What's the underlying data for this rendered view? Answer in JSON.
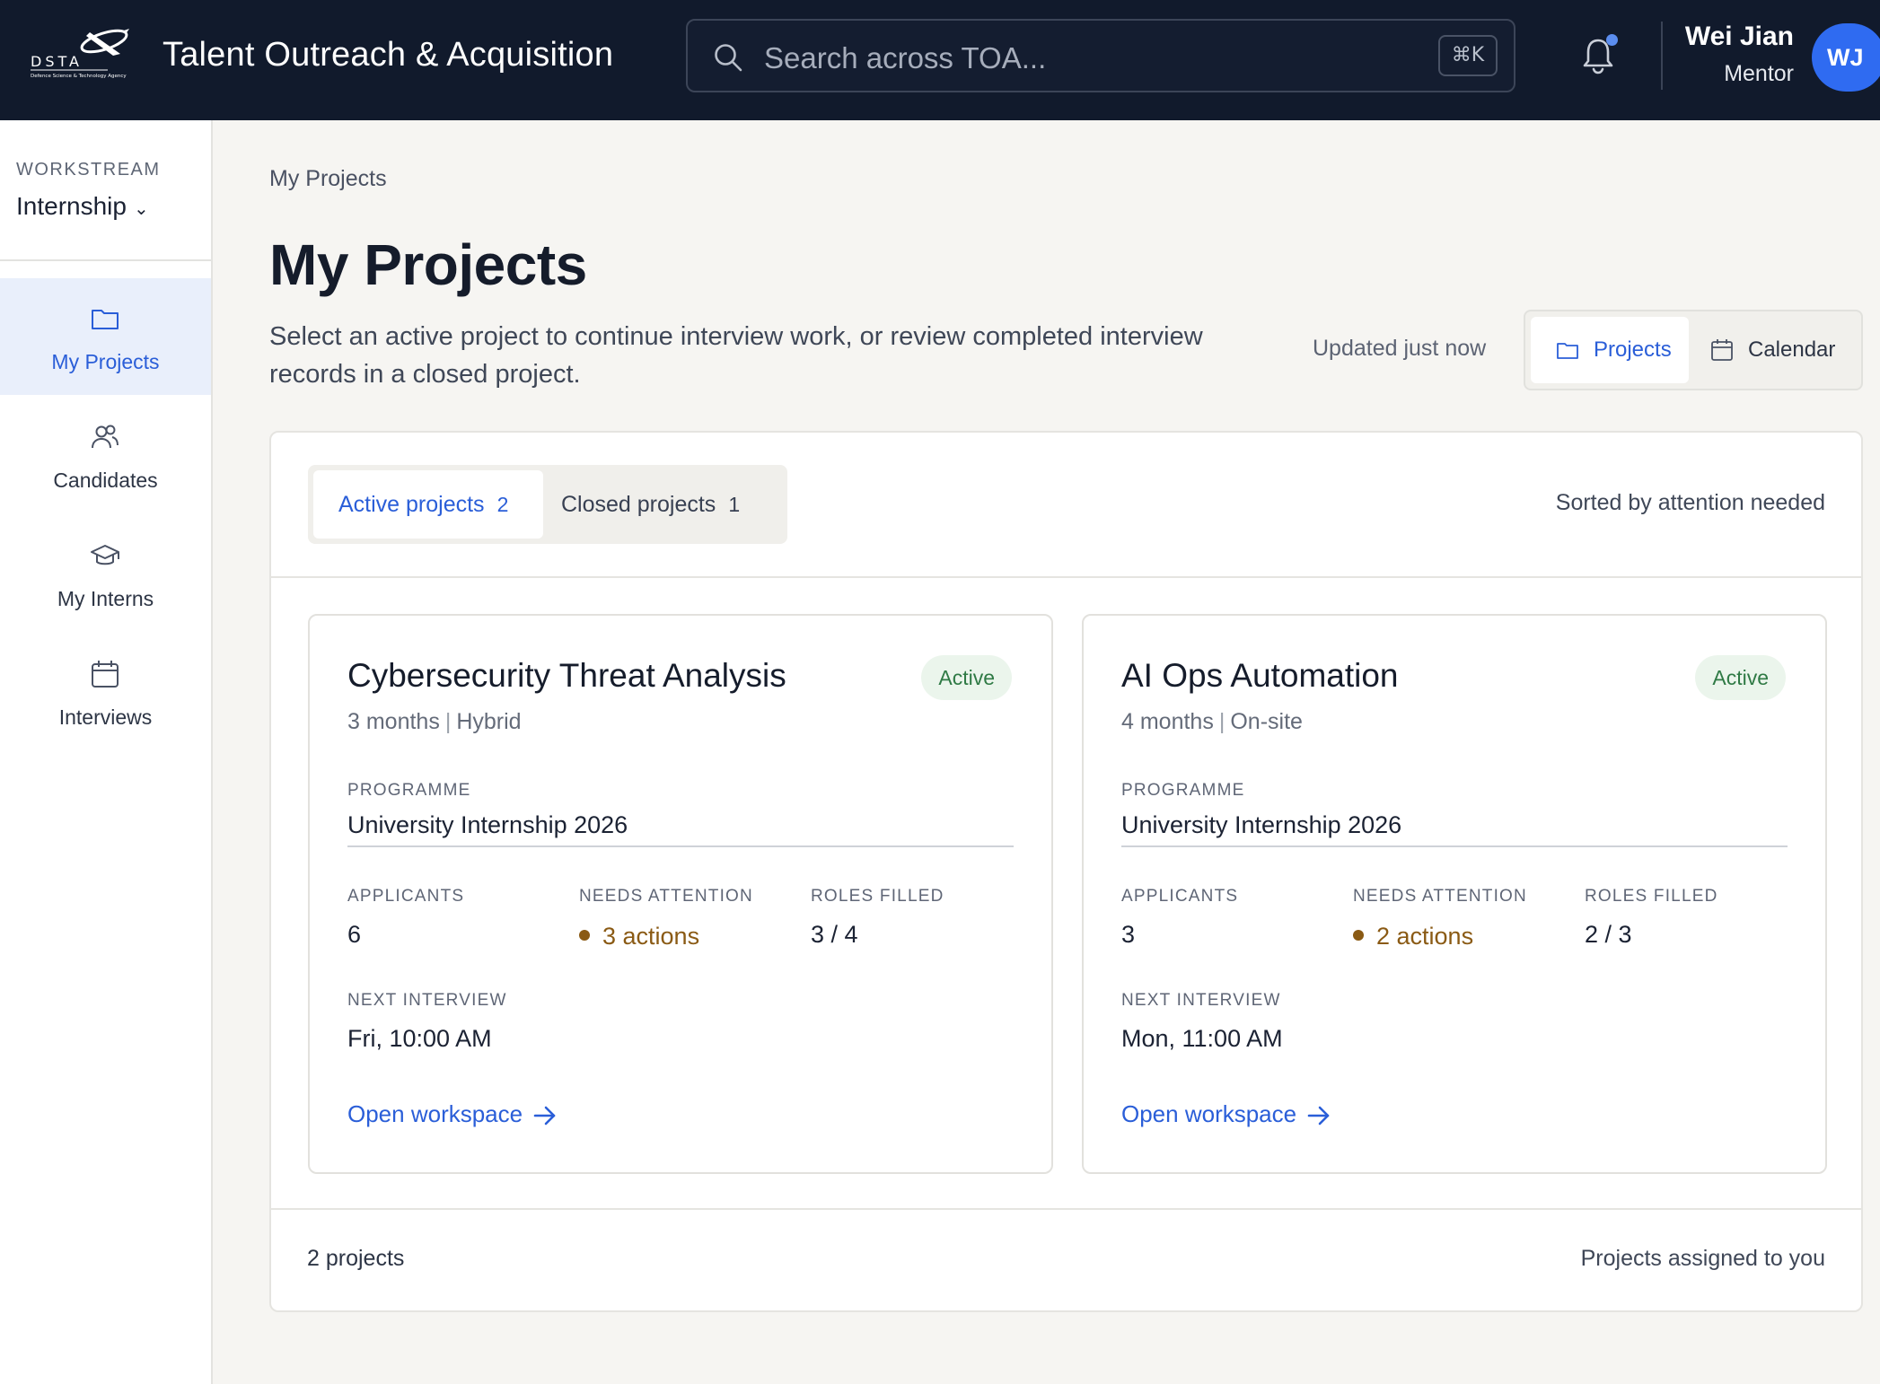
{
  "header": {
    "logo_text": "DSTA",
    "logo_subtext": "Defence Science & Technology Agency",
    "app_title": "Talent Outreach & Acquisition",
    "search_placeholder": "Search across TOA...",
    "search_shortcut": "⌘K",
    "notification_unread": true,
    "user_name": "Wei Jian",
    "user_role": "Mentor",
    "user_initials": "WJ"
  },
  "sidebar": {
    "workstream_label": "WORKSTREAM",
    "workstream_value": "Internship",
    "items": [
      {
        "label": "My Projects",
        "icon": "folder-icon",
        "active": true
      },
      {
        "label": "Candidates",
        "icon": "users-icon",
        "active": false
      },
      {
        "label": "My Interns",
        "icon": "graduation-cap-icon",
        "active": false
      },
      {
        "label": "Interviews",
        "icon": "calendar-icon",
        "active": false
      }
    ]
  },
  "main": {
    "breadcrumb": "My Projects",
    "title": "My Projects",
    "description": "Select an active project to continue interview work, or review completed interview records in a closed project.",
    "updated": "Updated just now",
    "view_toggle": {
      "projects": "Projects",
      "calendar": "Calendar",
      "selected": "Projects"
    },
    "tabs": [
      {
        "label": "Active projects",
        "count": "2",
        "active": true
      },
      {
        "label": "Closed projects",
        "count": "1",
        "active": false
      }
    ],
    "sort_note": "Sorted by attention needed",
    "cards": [
      {
        "title": "Cybersecurity Threat Analysis",
        "status": "Active",
        "duration": "3 months",
        "mode": "Hybrid",
        "programme_label": "PROGRAMME",
        "programme": "University Internship 2026",
        "applicants_label": "APPLICANTS",
        "applicants": "6",
        "attention_label": "NEEDS ATTENTION",
        "attention": "3 actions",
        "roles_label": "ROLES FILLED",
        "roles": "3 / 4",
        "next_label": "NEXT INTERVIEW",
        "next_interview": "Fri, 10:00 AM",
        "link": "Open workspace"
      },
      {
        "title": "AI Ops Automation",
        "status": "Active",
        "duration": "4 months",
        "mode": "On-site",
        "programme_label": "PROGRAMME",
        "programme": "University Internship 2026",
        "applicants_label": "APPLICANTS",
        "applicants": "3",
        "attention_label": "NEEDS ATTENTION",
        "attention": "2 actions",
        "roles_label": "ROLES FILLED",
        "roles": "2 / 3",
        "next_label": "NEXT INTERVIEW",
        "next_interview": "Mon, 11:00 AM",
        "link": "Open workspace"
      }
    ],
    "footer_count": "2 projects",
    "footer_note": "Projects assigned to you"
  },
  "colors": {
    "topbar": "#111a2c",
    "accent": "#2a5ed8",
    "active_badge_bg": "#ebf5ec",
    "active_badge_text": "#2f7a45",
    "attention": "#8a5a14",
    "page_bg": "#f6f5f2"
  }
}
